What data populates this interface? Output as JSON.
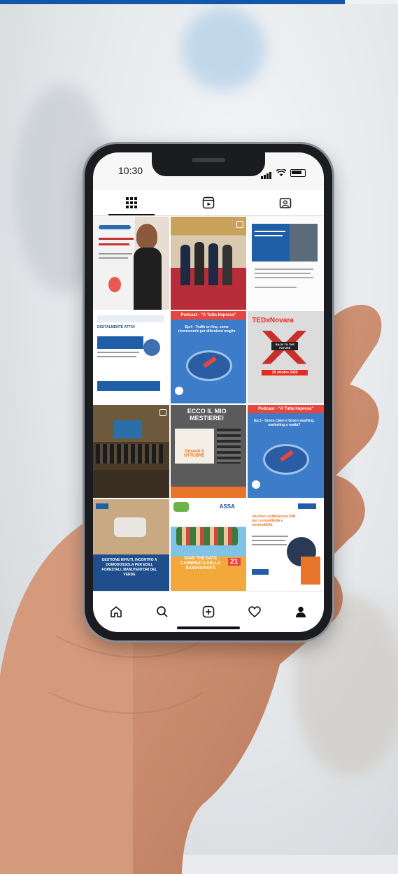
{
  "status_bar": {
    "time": "10:30"
  },
  "tabs": [
    {
      "icon": "grid-icon",
      "active": true
    },
    {
      "icon": "reels-icon",
      "active": false
    },
    {
      "icon": "tagged-icon",
      "active": false
    }
  ],
  "posts": [
    {
      "kind": "image",
      "desc": "woman-poster"
    },
    {
      "kind": "photo",
      "desc": "group-photo"
    },
    {
      "kind": "image",
      "desc": "info-poster"
    },
    {
      "kind": "image",
      "desc": "digitalmente-attivi",
      "text": "DIGITALMENTE ATTIVI"
    },
    {
      "kind": "image",
      "desc": "podcast-4",
      "title": "Podcast - \"A Tutta Impresa\"",
      "text": "Ep.4 - Truffe on line, come riconoscerle per difendersi meglio"
    },
    {
      "kind": "image",
      "desc": "tedx-novara",
      "title": "TEDxNovara",
      "text": "BACK TO THE FUTURE",
      "sub": "25 ottobre 2025"
    },
    {
      "kind": "photo",
      "desc": "meeting-room"
    },
    {
      "kind": "image",
      "desc": "ecco-il-mio-mestiere",
      "title": "ECCO IL MIO MESTIERE!",
      "text": "Giovedì 9 OTTOBRE"
    },
    {
      "kind": "image",
      "desc": "podcast-3",
      "title": "Podcast - \"A Tutta Impresa\"",
      "text": "Ep.3 - Green claim e Green washing, marketing o realtà?"
    },
    {
      "kind": "image",
      "desc": "gestione-rifiuti",
      "text": "GESTIONE RIFIUTI, INCONTRO A DOMODOSSOLA PER EDILI, FORESTALI, MANUTENTORI DEL VERDE"
    },
    {
      "kind": "image",
      "desc": "biodiversita",
      "title": "ASSA",
      "text": "SAVE THE DATE CAMMINATA DELLA BIODIVERSITÀ",
      "sub": "21"
    },
    {
      "kind": "image",
      "desc": "voucher",
      "title": "Voucher certificazioni PMI per competitività e sostenibilità"
    }
  ],
  "nav": [
    "home-icon",
    "search-icon",
    "add-icon",
    "heart-icon",
    "profile-icon"
  ]
}
